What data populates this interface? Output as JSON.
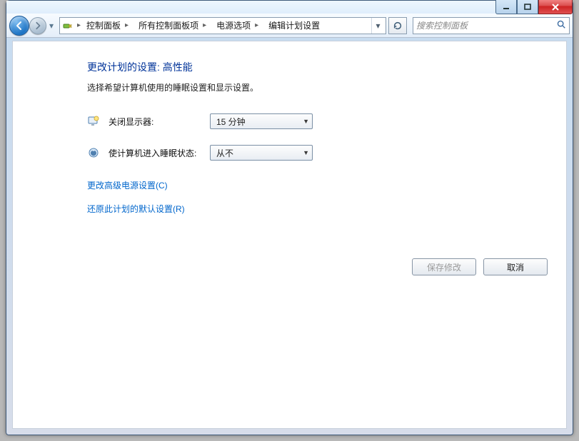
{
  "breadcrumbs": {
    "item0": "控制面板",
    "item1": "所有控制面板项",
    "item2": "电源选项",
    "item3": "编辑计划设置"
  },
  "search": {
    "placeholder": "搜索控制面板"
  },
  "page": {
    "title": "更改计划的设置: 高性能",
    "subtitle": "选择希望计算机使用的睡眠设置和显示设置。"
  },
  "settings": {
    "displayOff": {
      "label": "关闭显示器:",
      "value": "15 分钟"
    },
    "sleep": {
      "label": "使计算机进入睡眠状态:",
      "value": "从不"
    }
  },
  "links": {
    "advanced": "更改高级电源设置(C)",
    "restore": "还原此计划的默认设置(R)"
  },
  "buttons": {
    "save": "保存修改",
    "cancel": "取消"
  }
}
